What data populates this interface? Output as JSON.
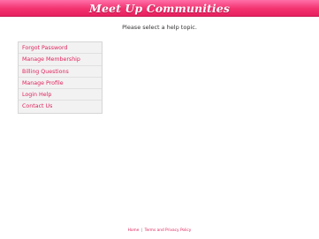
{
  "header": {
    "logo_text": "Meet Up Communities",
    "brand_color": "#f2326f"
  },
  "main": {
    "prompt": "Please select a help topic."
  },
  "help_topics": [
    {
      "label": "Forgot Password"
    },
    {
      "label": "Manage Membership"
    },
    {
      "label": "Billing Questions"
    },
    {
      "label": "Manage Profile"
    },
    {
      "label": "Login Help"
    },
    {
      "label": "Contact Us"
    }
  ],
  "footer": {
    "home_link": "Home",
    "separator": "|",
    "terms_link": "Terms and Privacy Policy"
  }
}
